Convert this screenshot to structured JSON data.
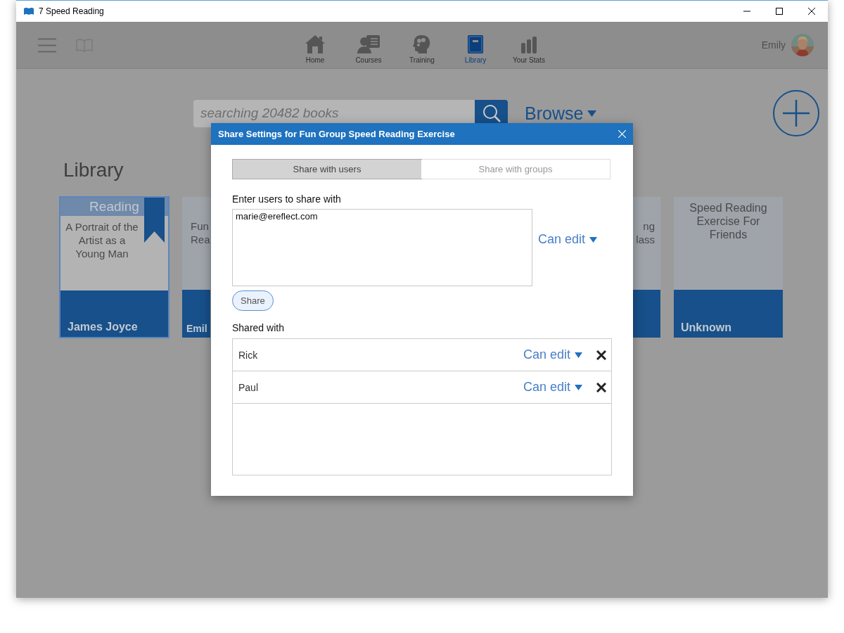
{
  "window": {
    "title": "7 Speed Reading"
  },
  "nav": [
    {
      "label": "Home",
      "selected": false
    },
    {
      "label": "Courses",
      "selected": false
    },
    {
      "label": "Training",
      "selected": false
    },
    {
      "label": "Library",
      "selected": true
    },
    {
      "label": "Your Stats",
      "selected": false
    }
  ],
  "user": {
    "name": "Emily"
  },
  "search": {
    "placeholder": "searching 20482 books"
  },
  "browse": {
    "label": "Browse"
  },
  "library": {
    "heading": "Library",
    "books": [
      {
        "kind": "full",
        "status": "Reading",
        "selected": true,
        "title": "A Portrait of the Artist as a Young Man",
        "author": "James Joyce"
      },
      {
        "kind": "cut-right",
        "selected": false,
        "lines": [
          "Fun",
          "Rea"
        ],
        "author": "Emil"
      },
      {
        "kind": "cut-left",
        "selected": false,
        "lines": [
          "ng",
          "lass"
        ]
      },
      {
        "kind": "full",
        "selected": false,
        "title": "Speed Reading Exercise For Friends",
        "author": "Unknown"
      }
    ]
  },
  "dialog": {
    "title": "Share Settings for Fun Group Speed Reading Exercise",
    "tabs": [
      {
        "label": "Share with users",
        "selected": true
      },
      {
        "label": "Share with groups",
        "selected": false
      }
    ],
    "users_label": "Enter users to share with",
    "users_value": "marie@ereflect.com",
    "permission": "Can edit",
    "share_button": "Share",
    "shared_label": "Shared with",
    "shared": [
      {
        "name": "Rick",
        "permission": "Can edit"
      },
      {
        "name": "Paul",
        "permission": "Can edit"
      }
    ]
  }
}
